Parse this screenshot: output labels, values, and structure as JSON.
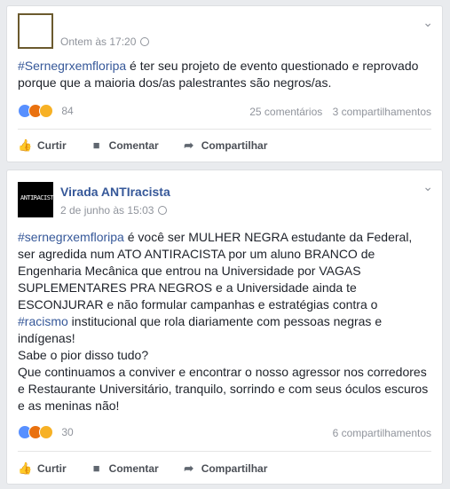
{
  "posts": [
    {
      "author": "",
      "timestamp": "Ontem às 17:20",
      "hashtag": "#Sernegrxemfloripa",
      "text": " é ter seu projeto de evento questionado e reprovado porque que a maioria dos/as palestrantes são negros/as.",
      "reaction_count": "84",
      "comments": "25 comentários",
      "shares": "3 compartilhamentos"
    },
    {
      "author": "Virada ANTIracista",
      "timestamp": "2 de junho às 15:03",
      "hashtag": "#sernegrxemfloripa",
      "text_part1": " é você ser MULHER NEGRA estudante da Federal, ser agredida num ATO ANTIRACISTA por um aluno BRANCO de Engenharia Mecânica que entrou na Universidade por VAGAS SUPLEMENTARES PRA NEGROS e a Universidade ainda te ESCONJURAR e não formular campanhas e estratégias contra o ",
      "hashtag2": "#racismo",
      "text_part2": " institucional que rola diariamente com pessoas negras e indígenas!",
      "line2": "Sabe o pior disso tudo?",
      "line3": "Que continuamos a conviver e encontrar o nosso agressor nos corredores e Restaurante Universitário, tranquilo, sorrindo e com seus óculos escuros e as meninas não!",
      "reaction_count": "30",
      "shares": "6 compartilhamentos"
    }
  ],
  "actions": {
    "like": "Curtir",
    "comment": "Comentar",
    "share": "Compartilhar"
  },
  "colors": {
    "link": "#365899",
    "meta": "#90949c",
    "background": "#e9ebee"
  },
  "icons": {
    "options": "chevron-down-icon",
    "privacy": "globe-icon",
    "like": "thumbs-up-icon",
    "comment": "speech-bubble-icon",
    "share": "share-arrow-icon"
  }
}
